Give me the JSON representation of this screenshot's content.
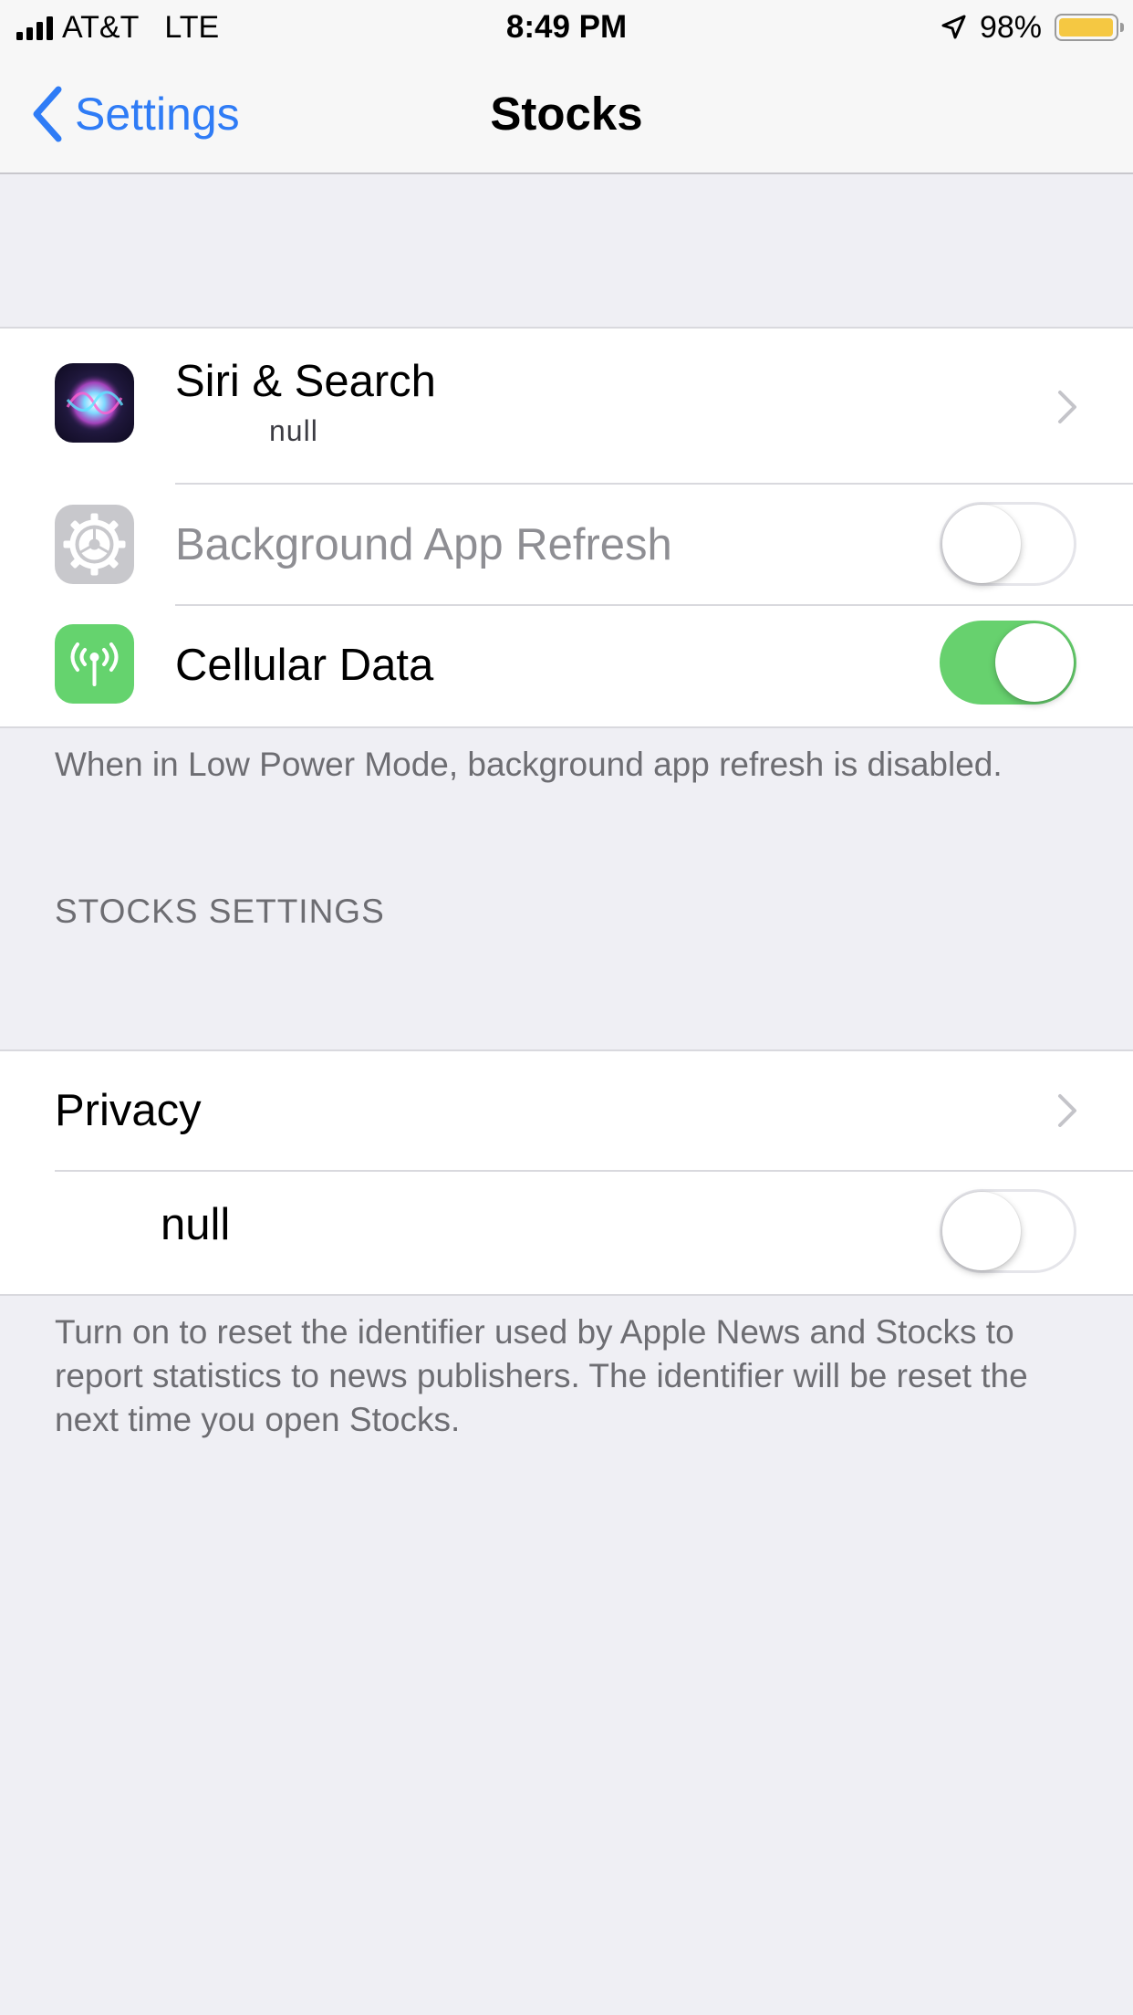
{
  "status_bar": {
    "carrier": "AT&T",
    "network": "LTE",
    "time": "8:49 PM",
    "battery_percent": "98%",
    "battery_level": 0.98,
    "battery_color": "#f5c842"
  },
  "nav": {
    "back_label": "Settings",
    "title": "Stocks",
    "accent_color": "#2f7cf6"
  },
  "group1": {
    "rows": [
      {
        "label": "Siri & Search",
        "sublabel": "null",
        "icon": "siri-icon",
        "accessory": "chevron"
      },
      {
        "label": "Background App Refresh",
        "icon": "gear-icon",
        "accessory": "toggle",
        "on": false,
        "enabled": false
      },
      {
        "label": "Cellular Data",
        "icon": "antenna-icon",
        "accessory": "toggle",
        "on": true,
        "enabled": true
      }
    ],
    "footnote": "When in Low Power Mode, background app refresh is disabled."
  },
  "section_header": "STOCKS SETTINGS",
  "group2": {
    "rows": [
      {
        "label": "Privacy",
        "accessory": "chevron"
      },
      {
        "label": "null",
        "accessory": "toggle",
        "on": false
      }
    ],
    "footnote": "Turn on to reset the identifier used by Apple News and Stocks to report statistics to news publishers. The identifier will be reset the next time you open Stocks."
  },
  "colors": {
    "toggle_on": "#67d16e",
    "background": "#efeff4"
  }
}
